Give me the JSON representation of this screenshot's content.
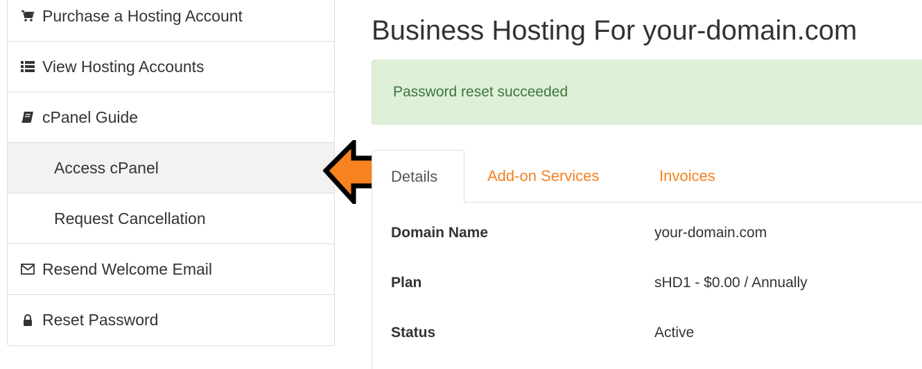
{
  "sidebar": {
    "items": [
      {
        "label": "Purchase a Hosting Account",
        "icon": "cart-icon"
      },
      {
        "label": "View Hosting Accounts",
        "icon": "list-icon"
      },
      {
        "label": "cPanel Guide",
        "icon": "book-icon"
      },
      {
        "label": "Access cPanel",
        "icon": ""
      },
      {
        "label": "Request Cancellation",
        "icon": ""
      },
      {
        "label": "Resend Welcome Email",
        "icon": "envelope-icon"
      },
      {
        "label": "Reset Password",
        "icon": "lock-icon"
      }
    ]
  },
  "main": {
    "title": "Business Hosting For your-domain.com",
    "alert": "Password reset succeeded",
    "tabs": [
      {
        "label": "Details",
        "active": true
      },
      {
        "label": "Add-on Services",
        "active": false
      },
      {
        "label": "Invoices",
        "active": false
      }
    ],
    "details": [
      {
        "key": "Domain Name",
        "value": "your-domain.com"
      },
      {
        "key": "Plan",
        "value": "sHD1 - $0.00 / Annually"
      },
      {
        "key": "Status",
        "value": "Active"
      }
    ]
  },
  "colors": {
    "accent": "#f48120",
    "alert_bg": "#dff0d8",
    "alert_text": "#3c763d",
    "arrow_fill": "#f7821f"
  }
}
